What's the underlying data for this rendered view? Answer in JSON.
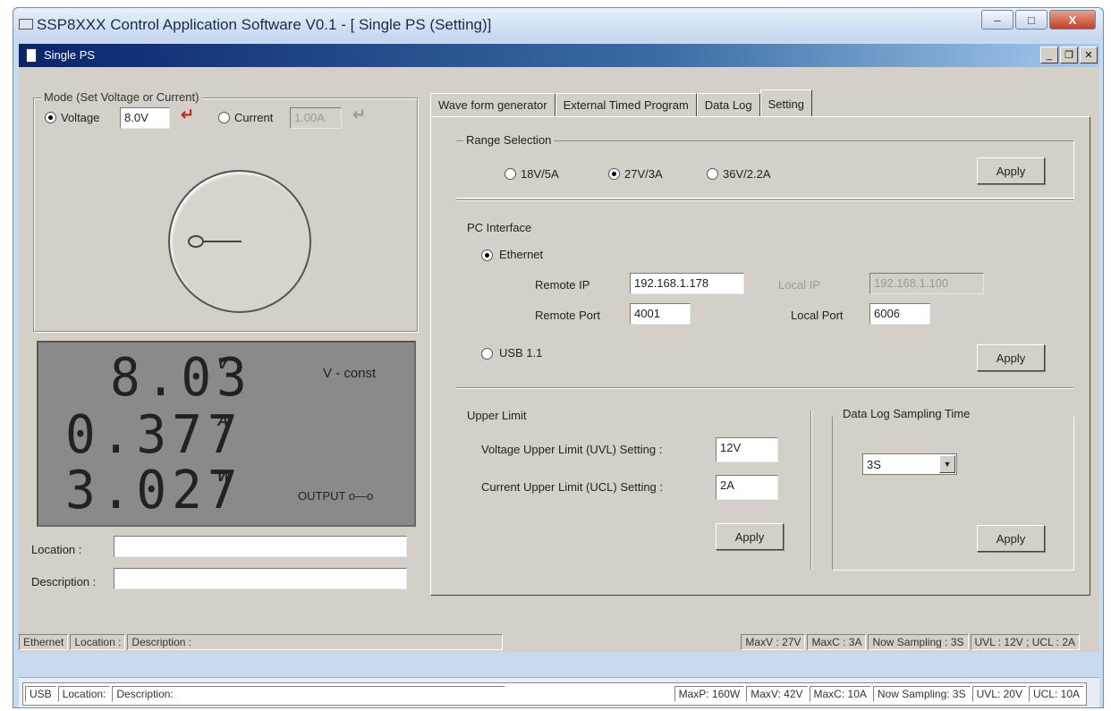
{
  "window": {
    "title": "SSP8XXX Control Application Software V0.1 - [ Single PS (Setting)]",
    "buttons": {
      "minimize": "–",
      "maximize": "□",
      "close": "X"
    }
  },
  "child_window": {
    "title": "Single PS",
    "buttons": {
      "minimize": "_",
      "restore": "❐",
      "close": "✕"
    }
  },
  "mode": {
    "caption": "Mode (Set Voltage or Current)",
    "voltage_label": "Voltage",
    "voltage_value": "8.0V",
    "voltage_selected": true,
    "current_label": "Current",
    "current_value": "1.00A",
    "current_selected": false
  },
  "lcd": {
    "voltage": "8.03",
    "voltage_unit": "V",
    "current": "0.377",
    "current_unit": "A",
    "power": "3.027",
    "power_unit": "W",
    "mode_status": "V - const",
    "output_label": "OUTPUT o—o"
  },
  "info": {
    "location_label": "Location :",
    "location_value": "",
    "description_label": "Description :",
    "description_value": ""
  },
  "tabs": [
    {
      "label": "Wave form generator",
      "active": false
    },
    {
      "label": "External Timed Program",
      "active": false
    },
    {
      "label": "Data Log",
      "active": false
    },
    {
      "label": "Setting",
      "active": true
    }
  ],
  "range": {
    "caption": "Range Selection",
    "options": [
      "18V/5A",
      "27V/3A",
      "36V/2.2A"
    ],
    "selected_index": 1,
    "apply_label": "Apply"
  },
  "pc_interface": {
    "caption": "PC Interface",
    "ethernet_label": "Ethernet",
    "ethernet_selected": true,
    "remote_ip_label": "Remote IP",
    "remote_ip_value": "192.168.1.178",
    "local_ip_label": "Local IP",
    "local_ip_value": "192.168.1.100",
    "remote_port_label": "Remote Port",
    "remote_port_value": "4001",
    "local_port_label": "Local Port",
    "local_port_value": "6006",
    "usb_label": "USB 1.1",
    "usb_selected": false,
    "apply_label": "Apply"
  },
  "upper_limit": {
    "caption": "Upper Limit",
    "uvl_label": "Voltage Upper Limit (UVL) Setting :",
    "uvl_value": "12V",
    "ucl_label": "Current Upper Limit (UCL) Setting :",
    "ucl_value": "2A",
    "apply_label": "Apply"
  },
  "data_log": {
    "caption": "Data Log Sampling Time",
    "selected": "3S",
    "apply_label": "Apply"
  },
  "status_ethernet": {
    "cells": [
      "Ethernet",
      "Location :",
      "Description :"
    ],
    "right_cells": [
      "MaxV : 27V",
      "MaxC : 3A",
      "Now Sampling : 3S",
      "UVL : 12V ; UCL : 2A"
    ]
  },
  "status_usb": {
    "cells": [
      "USB",
      "Location:",
      "Description:"
    ],
    "right_cells": [
      "MaxP: 160W",
      "MaxV: 42V",
      "MaxC: 10A",
      "Now Sampling: 3S",
      "UVL: 20V",
      "UCL: 10A"
    ]
  },
  "colors": {
    "enter_arrow_active": "#c0282a",
    "enter_arrow_disabled": "#9a9a9a",
    "lcd_bg": "#8a8a8a"
  }
}
